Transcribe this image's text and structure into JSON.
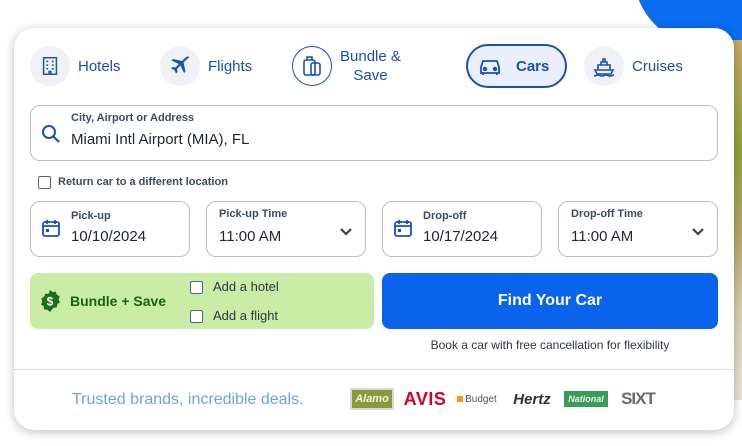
{
  "tabs": [
    {
      "label": "Hotels",
      "icon": "hotel-icon",
      "active": false
    },
    {
      "label": "Flights",
      "icon": "airplane-icon",
      "active": false
    },
    {
      "label": "Bundle & Save",
      "label_line1": "Bundle &",
      "label_line2": "Save",
      "icon": "luggage-icon",
      "active": false
    },
    {
      "label": "Cars",
      "icon": "car-icon",
      "active": true
    },
    {
      "label": "Cruises",
      "icon": "ship-icon",
      "active": false
    }
  ],
  "location": {
    "caption": "City, Airport or Address",
    "value": "Miami Intl Airport (MIA), FL"
  },
  "return_different": {
    "label": "Return car to a different location",
    "checked": false
  },
  "pickup": {
    "caption": "Pick-up",
    "value": "10/10/2024"
  },
  "pickup_time": {
    "caption": "Pick-up Time",
    "value": "11:00 AM"
  },
  "dropoff": {
    "caption": "Drop-off",
    "value": "10/17/2024"
  },
  "dropoff_time": {
    "caption": "Drop-off Time",
    "value": "11:00 AM"
  },
  "bundle": {
    "title": "Bundle + Save",
    "add_hotel": "Add a hotel",
    "add_flight": "Add a flight"
  },
  "find_button": "Find Your Car",
  "cancellation_note": "Book a car with free cancellation for flexibility",
  "trusted_text": "Trusted brands, incredible deals.",
  "brands": [
    "Alamo",
    "AVIS",
    "Budget",
    "Hertz",
    "National",
    "SIXT"
  ],
  "colors": {
    "primary": "#0a64eb",
    "tab_text": "#1a4fb5",
    "bundle_bg": "#c9eda6",
    "bundle_text": "#1d5e13",
    "avis_red": "#d4002a"
  }
}
